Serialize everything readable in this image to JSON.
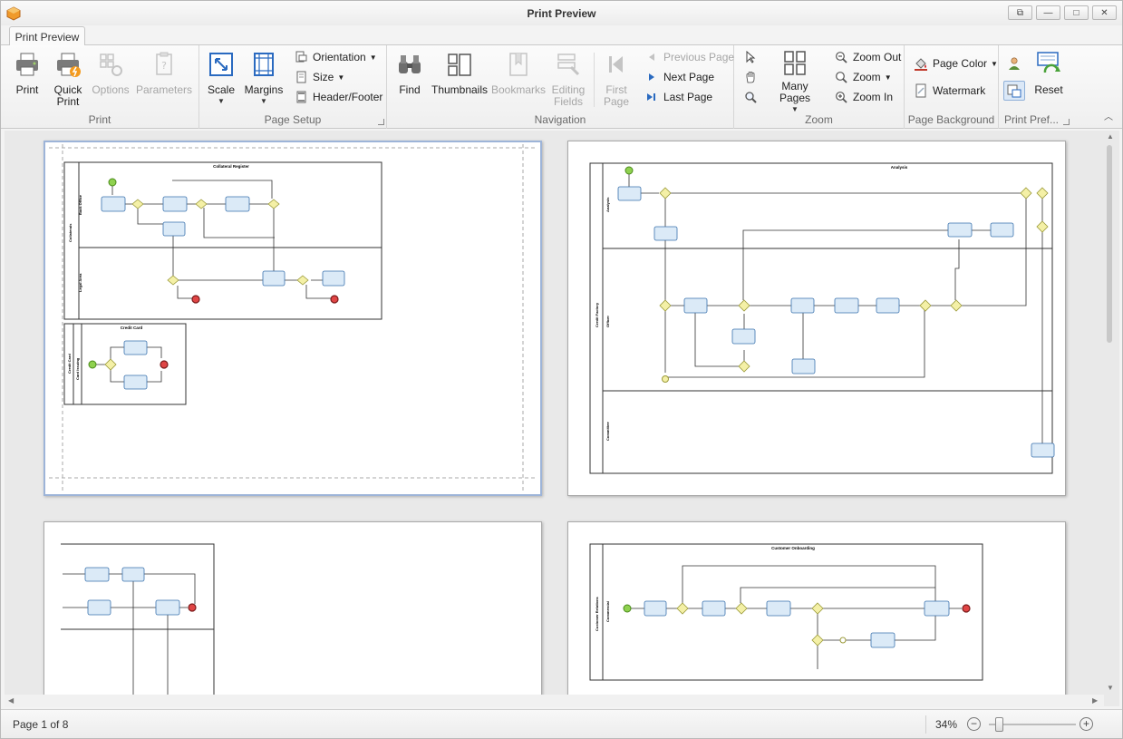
{
  "window": {
    "title": "Print Preview",
    "controls": [
      "restore",
      "minimize",
      "maximize",
      "close"
    ]
  },
  "tabs": [
    {
      "label": "Print Preview",
      "active": true
    }
  ],
  "ribbon": {
    "print_group": {
      "label": "Print",
      "print": "Print",
      "quick_print": "Quick Print",
      "options": "Options",
      "parameters": "Parameters"
    },
    "page_setup_group": {
      "label": "Page Setup",
      "scale": "Scale",
      "margins": "Margins",
      "orientation": "Orientation",
      "size": "Size",
      "header_footer": "Header/Footer"
    },
    "navigation_group": {
      "label": "Navigation",
      "find": "Find",
      "thumbnails": "Thumbnails",
      "bookmarks": "Bookmarks",
      "editing_fields": "Editing Fields",
      "first_page": "First Page",
      "previous_page": "Previous Page",
      "next_page": "Next Page",
      "last_page": "Last Page"
    },
    "zoom_group": {
      "label": "Zoom",
      "many_pages": "Many Pages",
      "zoom_out": "Zoom Out",
      "zoom": "Zoom",
      "zoom_in": "Zoom In"
    },
    "page_background_group": {
      "label": "Page Background",
      "page_color": "Page Color",
      "watermark": "Watermark"
    },
    "print_pref_group": {
      "label": "Print Pref...",
      "reset": "Reset"
    }
  },
  "diagrams": {
    "page1_title_a": "Collateral Register",
    "page1_title_b": "Credit Card",
    "page1_lane_outer": "Collaterals",
    "page1_lane_a": "Back Office",
    "page1_lane_b": "Legal Area",
    "page1_lane_c": "Credit Card",
    "page1_lane_d": "Card Issuing",
    "page2_title": "Analysis",
    "page2_lane_outer": "Credit Factory",
    "page2_lane_a": "Analysis",
    "page2_lane_b": "Officer",
    "page2_lane_c": "Committee",
    "page4_title": "Customer Onboarding",
    "page4_lane_outer": "Customer Relations",
    "page4_lane_a": "Commercial"
  },
  "status": {
    "page_info": "Page 1 of 8",
    "zoom_percent": "34%",
    "zoom_level": 0.34
  },
  "colors": {
    "accent": "#2a6ac0",
    "task_fill": "#dbeaf7",
    "task_stroke": "#3a72ad",
    "gateway_fill": "#f4f0a6",
    "start_event": "#8fd14f",
    "end_event": "#e04545",
    "selected_page_border": "#9db4d8"
  }
}
